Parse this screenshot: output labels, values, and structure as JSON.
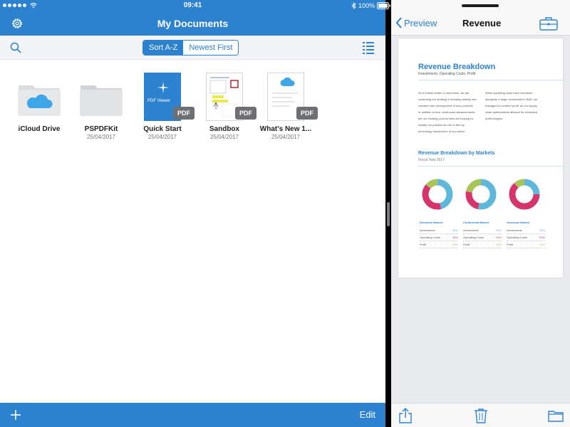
{
  "status_bar": {
    "time": "09:41",
    "battery": "100%"
  },
  "left": {
    "title": "My Documents",
    "sort_az": "Sort A-Z",
    "newest_first": "Newest First",
    "edit_label": "Edit",
    "documents": [
      {
        "name": "iCloud Drive",
        "date": "",
        "kind": "icloud-folder"
      },
      {
        "name": "PSPDFKit",
        "date": "25/04/2017",
        "kind": "folder"
      },
      {
        "name": "Quick Start",
        "date": "25/04/2017",
        "kind": "pdf",
        "badge": "PDF",
        "cover_text": "PDF Viewer"
      },
      {
        "name": "Sandbox",
        "date": "25/04/2017",
        "kind": "pdf",
        "badge": "PDF"
      },
      {
        "name": "What's New 1...",
        "date": "25/04/2017",
        "kind": "pdf",
        "badge": "PDF"
      }
    ]
  },
  "right": {
    "back_label": "Preview",
    "title": "Revenue",
    "document": {
      "heading": "Revenue Breakdown",
      "subheading": "Investments, Operating Costs, Profit",
      "col1": "As a market leader in innovation, we are continuing our strategy if investing heavily into research and development of new products. In addition to that, continuous advancements are our existing product lines are helping us solidify our position as one of the top technology researchers of our nation.",
      "col2": "While operating costs have increased alongside a larger investment in R&D, we managed to conform profit, as our supply chain optimizations allowed for increased profit margins.",
      "section_heading": "Revenue Breakdown by Markets",
      "section_sub": "Fiscal Year 2017",
      "markets": [
        {
          "name": "Domestic Market",
          "investments": "46%",
          "operating_costs": "40%",
          "profits": "15%",
          "shares": [
            0.46,
            0.4,
            0.14
          ]
        },
        {
          "name": "Continental Market",
          "investments": "53%",
          "operating_costs": "25%",
          "profits": "22%",
          "shares": [
            0.53,
            0.25,
            0.22
          ]
        },
        {
          "name": "Overseas Market",
          "investments": "25%",
          "operating_costs": "63%",
          "profits": "12%",
          "shares": [
            0.25,
            0.63,
            0.12
          ]
        }
      ],
      "row_labels": {
        "investments": "Investments",
        "operating_costs": "Operating Costs",
        "profits": "Profit"
      }
    }
  },
  "colors": {
    "accent": "#2d82cf",
    "chart_blue": "#5fb8dc",
    "chart_pink": "#d6346b",
    "chart_green": "#a9c55a"
  }
}
